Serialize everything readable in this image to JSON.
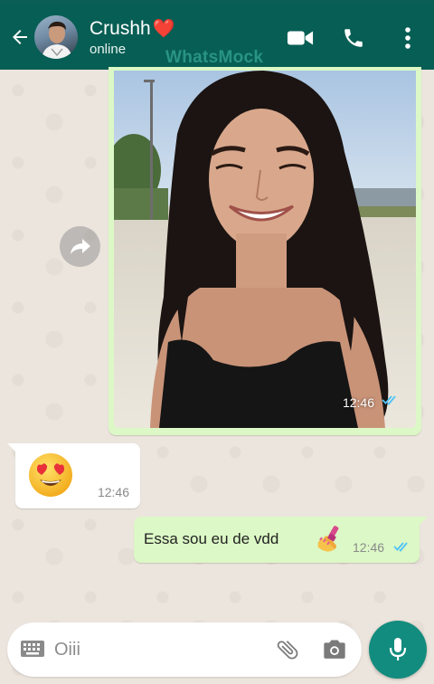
{
  "header": {
    "contact_name": "Crushh",
    "name_emoji": "❤️",
    "status": "online",
    "watermark": "WhatsMock",
    "bg_color": "#075e54"
  },
  "messages": [
    {
      "type": "image",
      "direction": "outgoing",
      "time": "12:46",
      "read": true
    },
    {
      "type": "emoji",
      "direction": "incoming",
      "emoji": "😍",
      "time": "12:46"
    },
    {
      "type": "text",
      "direction": "outgoing",
      "text": "Essa sou eu de vdd",
      "emoji": "💅",
      "time": "12:46",
      "read": true
    }
  ],
  "input": {
    "value": "Oiii"
  },
  "icons": {
    "back": "arrow-left-icon",
    "video": "video-camera-icon",
    "call": "phone-icon",
    "menu": "more-vertical-icon",
    "forward": "forward-arrow-icon",
    "keyboard": "keyboard-icon",
    "attach": "paperclip-icon",
    "camera": "camera-icon",
    "mic": "microphone-icon"
  },
  "colors": {
    "accent": "#128c7e",
    "outgoing_bubble": "#dcf8c6",
    "read_ticks": "#4fc3f7"
  }
}
